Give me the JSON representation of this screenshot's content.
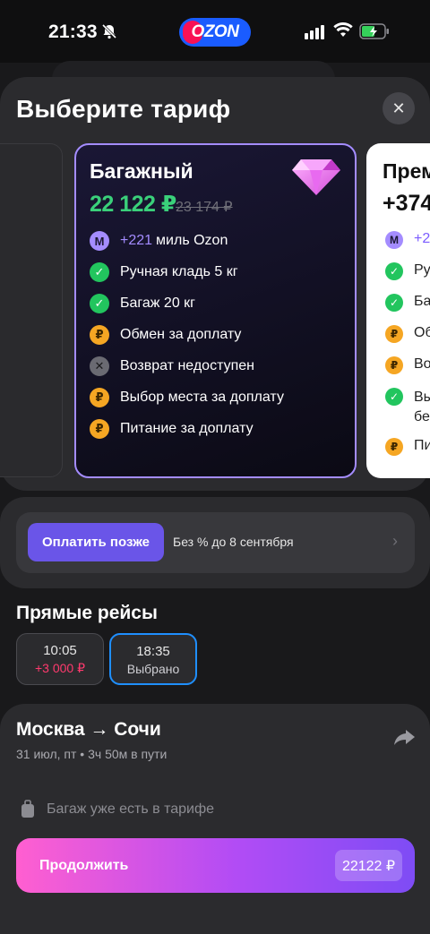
{
  "status_bar": {
    "time": "21:33"
  },
  "brand": {
    "logo_text": "OZON",
    "colors": {
      "blue": "#1a5cff",
      "pink": "#f91155"
    }
  },
  "sheet": {
    "title": "Выберите тариф",
    "close_icon": "close-icon"
  },
  "tariffs": {
    "selected": {
      "name": "Багажный",
      "price": "22 122 ₽",
      "old_price": "23 174 ₽",
      "features": [
        {
          "icon": "miles-icon",
          "accent": "+221",
          "text": "миль Ozon"
        },
        {
          "icon": "check-icon",
          "text": "Ручная кладь 5 кг"
        },
        {
          "icon": "check-icon",
          "text": "Багаж 20 кг"
        },
        {
          "icon": "ruble-icon",
          "text": "Обмен за доплату"
        },
        {
          "icon": "cross-icon",
          "text": "Возврат недоступен"
        },
        {
          "icon": "ruble-icon",
          "text": "Выбор места за доплату"
        },
        {
          "icon": "ruble-icon",
          "text": "Питание за доплату"
        }
      ]
    },
    "next": {
      "name": "Прем",
      "price": "+374",
      "features": [
        {
          "icon": "miles-icon",
          "text": "+2"
        },
        {
          "icon": "check-icon",
          "text": "Ру"
        },
        {
          "icon": "check-icon",
          "text": "Ба"
        },
        {
          "icon": "ruble-icon",
          "text": "Об"
        },
        {
          "icon": "ruble-icon",
          "text": "Во"
        },
        {
          "icon": "check-icon",
          "text": "Вы",
          "text2": "бе"
        },
        {
          "icon": "ruble-icon",
          "text": "Пи"
        }
      ]
    }
  },
  "pay_later": {
    "button": "Оплатить позже",
    "text": "Без % до 8 сентября"
  },
  "direct_flights": {
    "title": "Прямые рейсы",
    "options": [
      {
        "time": "10:05",
        "sub": "+3 000 ₽"
      },
      {
        "time": "18:35",
        "sub": "Выбрано"
      }
    ]
  },
  "summary": {
    "route": "Москва → Сочи",
    "details": "31 июл, пт • 3ч 50м в пути",
    "baggage_note": "Багаж уже есть в тарифе",
    "continue_label": "Продолжить",
    "continue_price": "22122 ₽"
  }
}
